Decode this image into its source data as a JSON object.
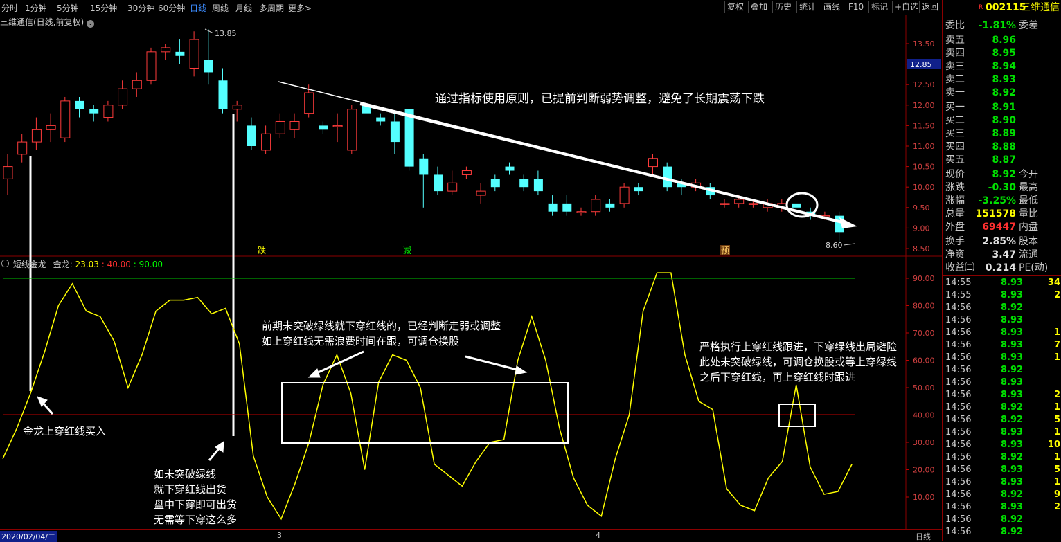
{
  "toolbar": {
    "periods": [
      "分时",
      "1分钟",
      "5分钟",
      "15分钟",
      "30分钟",
      "60分钟",
      "日线",
      "周线",
      "月线",
      "多周期",
      "更多>"
    ],
    "active_period": "日线",
    "right_buttons": [
      "复权",
      "叠加",
      "历史",
      "统计",
      "画线",
      "F10",
      "标记",
      "+自选",
      "返回"
    ]
  },
  "chart": {
    "title": "三维通信(日线,前复权)",
    "high_label": "13.85",
    "low_label": "8.60",
    "current_price_tag": "12.85",
    "markers": [
      "跌",
      "减",
      "预"
    ],
    "y_ticks": [
      "13.50",
      "13.00",
      "12.50",
      "12.00",
      "11.50",
      "11.00",
      "10.50",
      "10.00",
      "9.50",
      "9.00",
      "8.50"
    ]
  },
  "indicator": {
    "name": "短线金龙",
    "label": "金龙:",
    "value": "23.03",
    "level_red": ": 40.00",
    "level_green": ": 90.00",
    "y_ticks": [
      "90.00",
      "80.00",
      "70.00",
      "60.00",
      "50.00",
      "40.00",
      "30.00",
      "20.00",
      "10.00"
    ]
  },
  "date_axis": {
    "start": "2020/02/04/二",
    "m3": "3",
    "m4": "4",
    "period_label": "日线"
  },
  "annotations": {
    "top": "通过指标使用原则，已提前判断弱势调整，避免了长期震荡下跌",
    "buy": "金龙上穿红线买入",
    "sell": [
      "如未突破绿线",
      "就下穿红线出货",
      "盘中下穿即可出货",
      "无需等下穿这么多"
    ],
    "middle": [
      "前期未突破绿线就下穿红线的，已经判断走弱或调整",
      "如上穿红线无需浪费时间在跟，可调仓换股"
    ],
    "right": [
      "严格执行上穿红线跟进，下穿绿线出局避险",
      "此处未突破绿线，可调仓换股或等上穿绿线",
      "之后下穿红线，再上穿红线时跟进"
    ]
  },
  "quote": {
    "code": "002115",
    "name": "三维通信",
    "ratio_label": "委比",
    "ratio": "-1.81%",
    "diff_label": "委差",
    "asks": [
      {
        "label": "卖五",
        "price": "8.96"
      },
      {
        "label": "卖四",
        "price": "8.95"
      },
      {
        "label": "卖三",
        "price": "8.94"
      },
      {
        "label": "卖二",
        "price": "8.93"
      },
      {
        "label": "卖一",
        "price": "8.92"
      }
    ],
    "bids": [
      {
        "label": "买一",
        "price": "8.91"
      },
      {
        "label": "买二",
        "price": "8.90"
      },
      {
        "label": "买三",
        "price": "8.89"
      },
      {
        "label": "买四",
        "price": "8.88"
      },
      {
        "label": "买五",
        "price": "8.87"
      }
    ],
    "stats": [
      {
        "label": "现价",
        "value": "8.92",
        "color": "green",
        "label2": "今开"
      },
      {
        "label": "涨跌",
        "value": "-0.30",
        "color": "green",
        "label2": "最高"
      },
      {
        "label": "涨幅",
        "value": "-3.25%",
        "color": "green",
        "label2": "最低"
      },
      {
        "label": "总量",
        "value": "151578",
        "color": "yellow",
        "label2": "量比"
      },
      {
        "label": "外盘",
        "value": "69447",
        "color": "red",
        "label2": "内盘"
      }
    ],
    "stats2": [
      {
        "label": "换手",
        "value": "2.85%",
        "color": "white",
        "label2": "股本"
      },
      {
        "label": "净资",
        "value": "3.47",
        "color": "white",
        "label2": "流通"
      },
      {
        "label": "收益㈢",
        "value": "0.214",
        "color": "white",
        "label2": "PE(动)"
      }
    ]
  },
  "trades": [
    {
      "time": "14:55",
      "price": "8.93",
      "vol": "34"
    },
    {
      "time": "14:55",
      "price": "8.93",
      "vol": "2"
    },
    {
      "time": "14:56",
      "price": "8.92",
      "vol": ""
    },
    {
      "time": "14:56",
      "price": "8.93",
      "vol": ""
    },
    {
      "time": "14:56",
      "price": "8.93",
      "vol": "1"
    },
    {
      "time": "14:56",
      "price": "8.93",
      "vol": "7"
    },
    {
      "time": "14:56",
      "price": "8.93",
      "vol": "1"
    },
    {
      "time": "14:56",
      "price": "8.92",
      "vol": ""
    },
    {
      "time": "14:56",
      "price": "8.93",
      "vol": ""
    },
    {
      "time": "14:56",
      "price": "8.93",
      "vol": "2"
    },
    {
      "time": "14:56",
      "price": "8.92",
      "vol": "1"
    },
    {
      "time": "14:56",
      "price": "8.92",
      "vol": "5"
    },
    {
      "time": "14:56",
      "price": "8.93",
      "vol": "1"
    },
    {
      "time": "14:56",
      "price": "8.93",
      "vol": "10"
    },
    {
      "time": "14:56",
      "price": "8.92",
      "vol": "1"
    },
    {
      "time": "14:56",
      "price": "8.93",
      "vol": "5"
    },
    {
      "time": "14:56",
      "price": "8.93",
      "vol": "1"
    },
    {
      "time": "14:56",
      "price": "8.92",
      "vol": "9"
    },
    {
      "time": "14:56",
      "price": "8.93",
      "vol": "2"
    },
    {
      "time": "14:56",
      "price": "8.92",
      "vol": ""
    },
    {
      "time": "14:56",
      "price": "8.92",
      "vol": ""
    }
  ],
  "candles": [
    [
      10.2,
      10.8,
      9.8,
      10.5
    ],
    [
      10.8,
      11.3,
      10.6,
      11.1
    ],
    [
      11.1,
      11.7,
      10.9,
      11.4
    ],
    [
      11.4,
      11.8,
      11.1,
      11.5
    ],
    [
      11.2,
      12.2,
      11.1,
      12.1
    ],
    [
      12.1,
      12.2,
      11.7,
      11.9
    ],
    [
      11.9,
      12.0,
      11.6,
      11.8
    ],
    [
      11.7,
      12.1,
      11.6,
      12.0
    ],
    [
      12.0,
      12.6,
      11.9,
      12.4
    ],
    [
      12.4,
      12.8,
      12.2,
      12.6
    ],
    [
      12.6,
      13.4,
      12.5,
      13.3
    ],
    [
      13.3,
      13.5,
      13.1,
      13.4
    ],
    [
      13.3,
      13.6,
      13.0,
      13.2
    ],
    [
      12.9,
      13.8,
      12.7,
      13.6
    ],
    [
      13.1,
      13.85,
      12.5,
      12.8
    ],
    [
      12.6,
      12.9,
      11.8,
      11.9
    ],
    [
      11.9,
      12.1,
      11.6,
      12.0
    ],
    [
      11.5,
      11.7,
      10.9,
      11.0
    ],
    [
      10.9,
      11.5,
      10.8,
      11.3
    ],
    [
      11.3,
      11.8,
      11.2,
      11.6
    ],
    [
      11.4,
      11.8,
      11.2,
      11.6
    ],
    [
      11.8,
      12.5,
      11.7,
      12.3
    ],
    [
      11.5,
      11.6,
      11.3,
      11.4
    ],
    [
      11.5,
      11.8,
      11.1,
      11.5
    ],
    [
      10.9,
      12.0,
      10.8,
      11.9
    ],
    [
      12.0,
      12.6,
      11.8,
      11.8
    ],
    [
      11.7,
      11.8,
      11.5,
      11.6
    ],
    [
      11.6,
      11.8,
      10.8,
      11.1
    ],
    [
      11.9,
      11.9,
      10.4,
      10.5
    ],
    [
      10.7,
      10.8,
      9.5,
      10.3
    ],
    [
      10.3,
      10.5,
      9.8,
      9.9
    ],
    [
      9.9,
      10.4,
      9.8,
      10.1
    ],
    [
      10.3,
      10.5,
      10.2,
      10.4
    ],
    [
      9.8,
      10.1,
      9.6,
      9.9
    ],
    [
      10.2,
      10.3,
      9.9,
      10.0
    ],
    [
      10.5,
      10.6,
      10.3,
      10.4
    ],
    [
      10.2,
      10.3,
      9.9,
      10.0
    ],
    [
      10.2,
      10.4,
      9.8,
      9.9
    ],
    [
      9.6,
      9.8,
      9.3,
      9.4
    ],
    [
      9.6,
      9.8,
      9.3,
      9.4
    ],
    [
      9.4,
      9.5,
      9.3,
      9.4
    ],
    [
      9.4,
      9.8,
      9.3,
      9.7
    ],
    [
      9.6,
      9.7,
      9.4,
      9.5
    ],
    [
      9.6,
      10.1,
      9.5,
      10.0
    ],
    [
      10.0,
      10.1,
      9.8,
      9.9
    ],
    [
      10.5,
      10.8,
      10.3,
      10.7
    ],
    [
      10.5,
      10.6,
      9.9,
      10.0
    ],
    [
      10.1,
      10.2,
      9.8,
      10.0
    ],
    [
      10.0,
      10.2,
      9.9,
      10.1
    ],
    [
      10.0,
      10.1,
      9.7,
      9.8
    ],
    [
      9.6,
      9.7,
      9.5,
      9.6
    ],
    [
      9.6,
      9.8,
      9.5,
      9.7
    ],
    [
      9.6,
      9.7,
      9.5,
      9.6
    ],
    [
      9.5,
      9.7,
      9.4,
      9.6
    ],
    [
      9.5,
      9.7,
      9.4,
      9.6
    ],
    [
      9.6,
      9.7,
      9.4,
      9.5
    ],
    [
      9.4,
      9.5,
      9.2,
      9.3
    ],
    [
      9.3,
      9.4,
      9.2,
      9.3
    ],
    [
      9.3,
      9.4,
      8.6,
      8.9
    ]
  ],
  "kdj": [
    24,
    35,
    48,
    63,
    80,
    88,
    78,
    76,
    67,
    50,
    62,
    78,
    82,
    82,
    83,
    77,
    79,
    66,
    25,
    10,
    2,
    15,
    30,
    51,
    62,
    48,
    20,
    52,
    62,
    60,
    50,
    22,
    18,
    14,
    23,
    30,
    31,
    60,
    76,
    60,
    35,
    17,
    7,
    3,
    24,
    40,
    78,
    92,
    92,
    62,
    45,
    42,
    13,
    7,
    5,
    17,
    23,
    51,
    21,
    11,
    12,
    22
  ]
}
